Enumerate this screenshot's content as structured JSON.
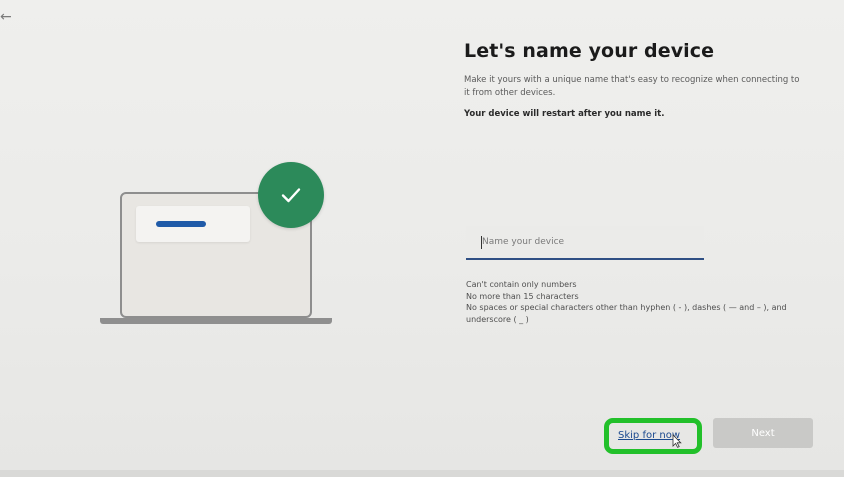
{
  "nav": {
    "back_glyph": "←",
    "back_icon": "arrow-left-icon"
  },
  "page": {
    "title": "Let's name your device",
    "description": "Make it yours with a unique name that's easy to recognize when connecting to it from other devices.",
    "restart_note": "Your device will restart after you name it."
  },
  "device_name_input": {
    "placeholder": "Name your device",
    "value": ""
  },
  "rules": [
    "Can't contain only numbers",
    "No more than 15 characters",
    "No spaces or special characters other than hyphen ( - ), dashes ( — and – ), and underscore ( _ )"
  ],
  "actions": {
    "skip_label": "Skip for now",
    "next_label": "Next"
  },
  "colors": {
    "accent": "#1f5aa8",
    "check_badge": "#2c8a5a",
    "highlight": "#22c02a",
    "next_disabled": "#c9c9c7"
  }
}
